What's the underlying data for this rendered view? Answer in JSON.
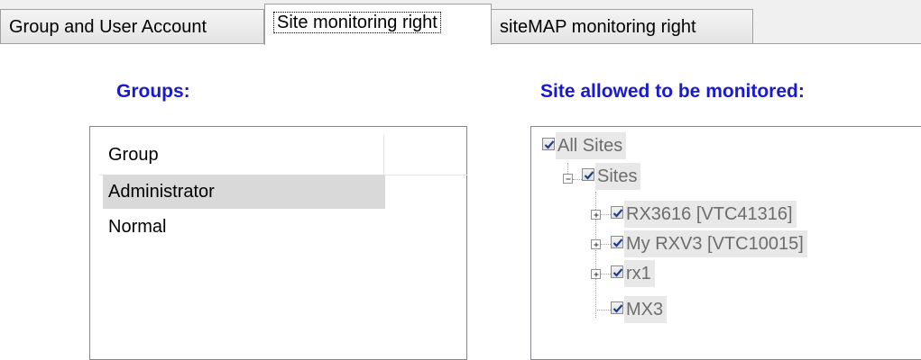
{
  "tabs": [
    {
      "label": "Group and User Account",
      "active": false
    },
    {
      "label": "Site monitoring right",
      "active": true
    },
    {
      "label": "siteMAP monitoring right",
      "active": false
    }
  ],
  "groups_heading": "Groups:",
  "sites_heading": "Site allowed to be monitored:",
  "groups_list": {
    "column_header": "Group",
    "rows": [
      {
        "name": "Administrator",
        "selected": true
      },
      {
        "name": "Normal",
        "selected": false
      }
    ]
  },
  "site_tree": {
    "root": {
      "label": "All Sites",
      "checked": true
    },
    "sites": {
      "label": "Sites",
      "checked": true,
      "expanded": true
    },
    "children": [
      {
        "label": "RX3616 [VTC41316]",
        "checked": true,
        "expandable": true
      },
      {
        "label": "My RXV3 [VTC10015]",
        "checked": true,
        "expandable": true
      },
      {
        "label": "rx1",
        "checked": true,
        "expandable": true
      },
      {
        "label": "MX3",
        "checked": true,
        "expandable": false
      }
    ]
  },
  "colors": {
    "heading": "#1a1acd",
    "disabled_text": "#6d6d6d",
    "selection": "#d9d9d9"
  }
}
